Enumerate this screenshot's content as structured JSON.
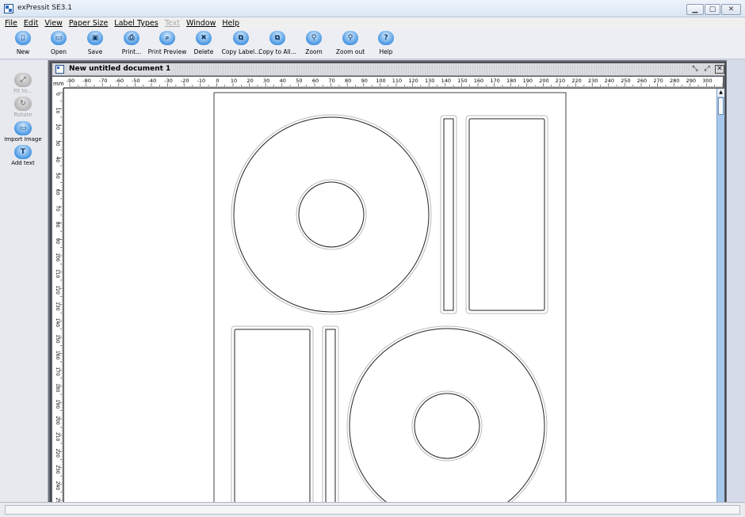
{
  "window": {
    "title": "exPressit SE3.1"
  },
  "menu": [
    {
      "label": "File",
      "enabled": true
    },
    {
      "label": "Edit",
      "enabled": true
    },
    {
      "label": "View",
      "enabled": true
    },
    {
      "label": "Paper Size",
      "enabled": true
    },
    {
      "label": "Label Types",
      "enabled": true
    },
    {
      "label": "Text",
      "enabled": false
    },
    {
      "label": "Window",
      "enabled": true
    },
    {
      "label": "Help",
      "enabled": true
    }
  ],
  "toolbar": [
    {
      "label": "New",
      "icon": "new-document-icon",
      "glyph": "▯"
    },
    {
      "label": "Open",
      "icon": "open-folder-icon",
      "glyph": "▭"
    },
    {
      "label": "Save",
      "icon": "save-disk-icon",
      "glyph": "▣"
    },
    {
      "label": "Print...",
      "icon": "printer-icon",
      "glyph": "⎙"
    },
    {
      "label": "Print Preview",
      "icon": "print-preview-icon",
      "glyph": "⌕"
    },
    {
      "label": "Delete",
      "icon": "delete-icon",
      "glyph": "✖"
    },
    {
      "label": "Copy Label...",
      "icon": "copy-label-icon",
      "glyph": "⧉"
    },
    {
      "label": "Copy to All...",
      "icon": "copy-to-all-icon",
      "glyph": "⧉"
    },
    {
      "label": "Zoom",
      "icon": "zoom-in-icon",
      "glyph": "⚲"
    },
    {
      "label": "Zoom out",
      "icon": "zoom-out-icon",
      "glyph": "⚲"
    },
    {
      "label": "Help",
      "icon": "help-icon",
      "glyph": "?"
    }
  ],
  "side_tools": [
    {
      "label": "Fit to...",
      "icon": "fit-to-icon",
      "glyph": "⤢",
      "enabled": false
    },
    {
      "label": "Rotate",
      "icon": "rotate-icon",
      "glyph": "↻",
      "enabled": false
    },
    {
      "label": "Import Image",
      "icon": "import-image-icon",
      "glyph": "▭",
      "enabled": true
    },
    {
      "label": "Add text",
      "icon": "add-text-icon",
      "glyph": "T",
      "enabled": true
    }
  ],
  "document": {
    "title": "New untitled document 1",
    "ruler_unit": "mm",
    "ruler_top_labels": [
      "-90",
      "-80",
      "-70",
      "-60",
      "-50",
      "-40",
      "-30",
      "-20",
      "-10",
      "0",
      "10",
      "20",
      "30",
      "40",
      "50",
      "60",
      "70",
      "80",
      "90",
      "100",
      "110",
      "120",
      "130",
      "140",
      "150",
      "160",
      "170",
      "180",
      "190",
      "200",
      "210",
      "220",
      "230",
      "240",
      "250",
      "260",
      "270",
      "280",
      "290",
      "300"
    ],
    "ruler_left_labels": [
      "0",
      "10",
      "20",
      "30",
      "40",
      "50",
      "60",
      "70",
      "80",
      "90",
      "100",
      "110",
      "120",
      "130",
      "140",
      "150",
      "160",
      "170",
      "180",
      "190",
      "200",
      "210",
      "220",
      "230",
      "240",
      "250"
    ]
  },
  "colors": {
    "toolbar_icon": "#4a97e2",
    "mdi_background": "#6b6f78",
    "scrollbar": "#a7c8ea"
  }
}
